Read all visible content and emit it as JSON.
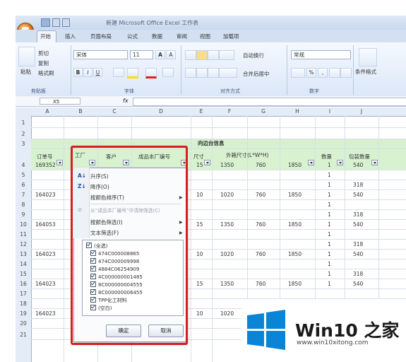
{
  "app": {
    "title_bar": "新建 Microsoft Office Excel 工作表"
  },
  "ribbon": {
    "tabs": [
      "开始",
      "插入",
      "页面布局",
      "公式",
      "数据",
      "审阅",
      "视图",
      "加载项"
    ],
    "paste_label": "粘贴",
    "cut_label": "剪切",
    "copy_label": "复制",
    "format_painter_label": "格式刷",
    "font_name": "宋体",
    "font_size": "11",
    "wrap_text_label": "自动换行",
    "merge_center_label": "合并后居中",
    "number_format": "常规",
    "conditional_format_label": "条件格式",
    "group_labels": [
      "剪贴板",
      "字体",
      "对齐方式",
      "数字"
    ]
  },
  "formula_bar": {
    "name_box": "X5",
    "fx": "fx"
  },
  "sheet": {
    "columns": [
      "A",
      "B",
      "C",
      "D",
      "E",
      "F",
      "G",
      "H",
      "I",
      "J"
    ],
    "rows": [
      "1",
      "2",
      "3",
      "4",
      "5",
      "6",
      "7",
      "8",
      "9",
      "10",
      "11",
      "12",
      "13",
      "14",
      "15",
      "16",
      "17",
      "18",
      "19",
      "20",
      "21"
    ],
    "title": "向边台信息",
    "headers": {
      "a": "订单号",
      "b": "工厂",
      "c": "客户",
      "d": "成品本厂编号",
      "e": "尺寸",
      "fgh": "外箱尺寸(L*W*H)",
      "i": "数量",
      "j": "包装数量"
    },
    "data_rows": [
      {
        "row": "4",
        "a": "169352",
        "e": "15",
        "f": "1350",
        "g": "760",
        "h": "1850",
        "i": "1",
        "j": "540"
      },
      {
        "row": "5",
        "i": "1"
      },
      {
        "row": "6",
        "i": "1",
        "j": "318"
      },
      {
        "row": "7",
        "a": "164023",
        "e": "10",
        "f": "1020",
        "g": "760",
        "h": "1850",
        "i": "1",
        "j": "540"
      },
      {
        "row": "8",
        "i": "1"
      },
      {
        "row": "9",
        "i": "1",
        "j": "318"
      },
      {
        "row": "10",
        "a": "164053",
        "e": "15",
        "f": "1350",
        "g": "760",
        "h": "1850",
        "i": "1",
        "j": "540"
      },
      {
        "row": "11",
        "i": "1"
      },
      {
        "row": "12",
        "i": "1",
        "j": "318"
      },
      {
        "row": "13",
        "a": "164023",
        "e": "10",
        "f": "1020",
        "g": "760",
        "h": "1850",
        "i": "1",
        "j": "540"
      },
      {
        "row": "14",
        "i": "1"
      },
      {
        "row": "15",
        "i": "1",
        "j": "318"
      },
      {
        "row": "16",
        "a": "164023",
        "e": "15",
        "f": "1350",
        "g": "760",
        "h": "1850",
        "i": "1",
        "j": "540"
      },
      {
        "row": "19",
        "a": "164023",
        "e": "10",
        "f": "1020"
      }
    ]
  },
  "filter_menu": {
    "items": [
      {
        "label": "升序(S)",
        "enabled": true,
        "submenu": false
      },
      {
        "label": "降序(O)",
        "enabled": true,
        "submenu": false
      },
      {
        "label": "按颜色排序(T)",
        "enabled": true,
        "submenu": true
      },
      {
        "label": "从“成品本厂编号”中清除筛选(C)",
        "enabled": false,
        "submenu": false
      },
      {
        "label": "按颜色筛选(I)",
        "enabled": true,
        "submenu": true
      },
      {
        "label": "文本筛选(F)",
        "enabled": true,
        "submenu": true
      }
    ],
    "checklist": [
      "(全选)",
      "474C000008865",
      "474C000009998",
      "4884C06254909",
      "4C000000001485",
      "8C000000004555",
      "8C000000006455",
      "TPP化工材料",
      "(空白)"
    ],
    "ok_label": "确定",
    "cancel_label": "取消"
  },
  "watermark": {
    "title": "Win10 之家",
    "url": "www.win10xitong.com"
  },
  "colors": {
    "highlight": "#d42020",
    "header_fill": "#d8f2d0",
    "win_blue": "#0a84d6"
  }
}
